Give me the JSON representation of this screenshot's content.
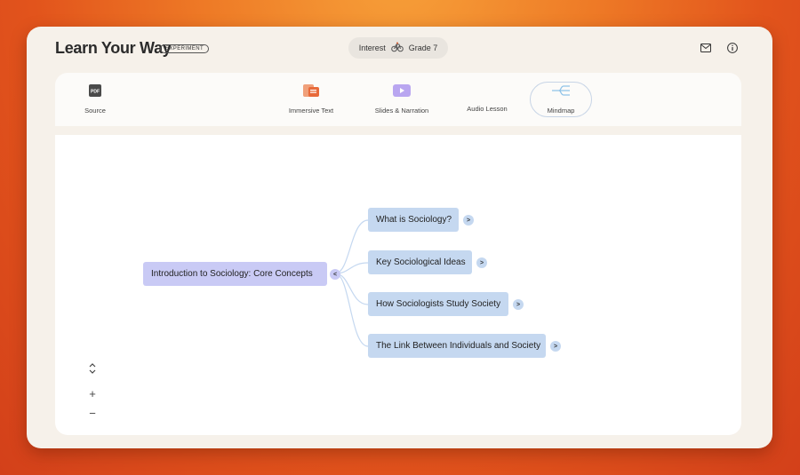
{
  "app": {
    "title": "Learn Your Way",
    "badge": "EXPERIMENT"
  },
  "header": {
    "interest_label": "Interest",
    "interest_icon": "bicycle-icon",
    "grade_label": "Grade 7",
    "icons": [
      "mail-icon",
      "info-icon"
    ]
  },
  "tabs": [
    {
      "label": "Source",
      "icon": "pdf-icon"
    },
    {
      "label": "Immersive Text",
      "icon": "document-icon"
    },
    {
      "label": "Slides & Narration",
      "icon": "slides-play-icon"
    },
    {
      "label": "Audio Lesson",
      "icon": "audio-icon"
    },
    {
      "label": "Mindmap",
      "icon": "mindmap-icon",
      "active": true
    }
  ],
  "mindmap": {
    "root": {
      "label": "Introduction to Sociology: Core Concepts",
      "toggle": "<"
    },
    "children": [
      {
        "label": "What is Sociology?",
        "toggle": ">"
      },
      {
        "label": "Key Sociological Ideas",
        "toggle": ">"
      },
      {
        "label": "How Sociologists Study Society",
        "toggle": ">"
      },
      {
        "label": "The Link Between Individuals and Society",
        "toggle": ">"
      }
    ]
  },
  "controls": {
    "expand": "⌃⌄",
    "zoom_in": "+",
    "zoom_out": "−"
  },
  "colors": {
    "root_node": "#c9caf5",
    "child_node": "#c5d8f0",
    "accent_orange": "#e86a3a",
    "accent_purple": "#b9a6f0"
  }
}
